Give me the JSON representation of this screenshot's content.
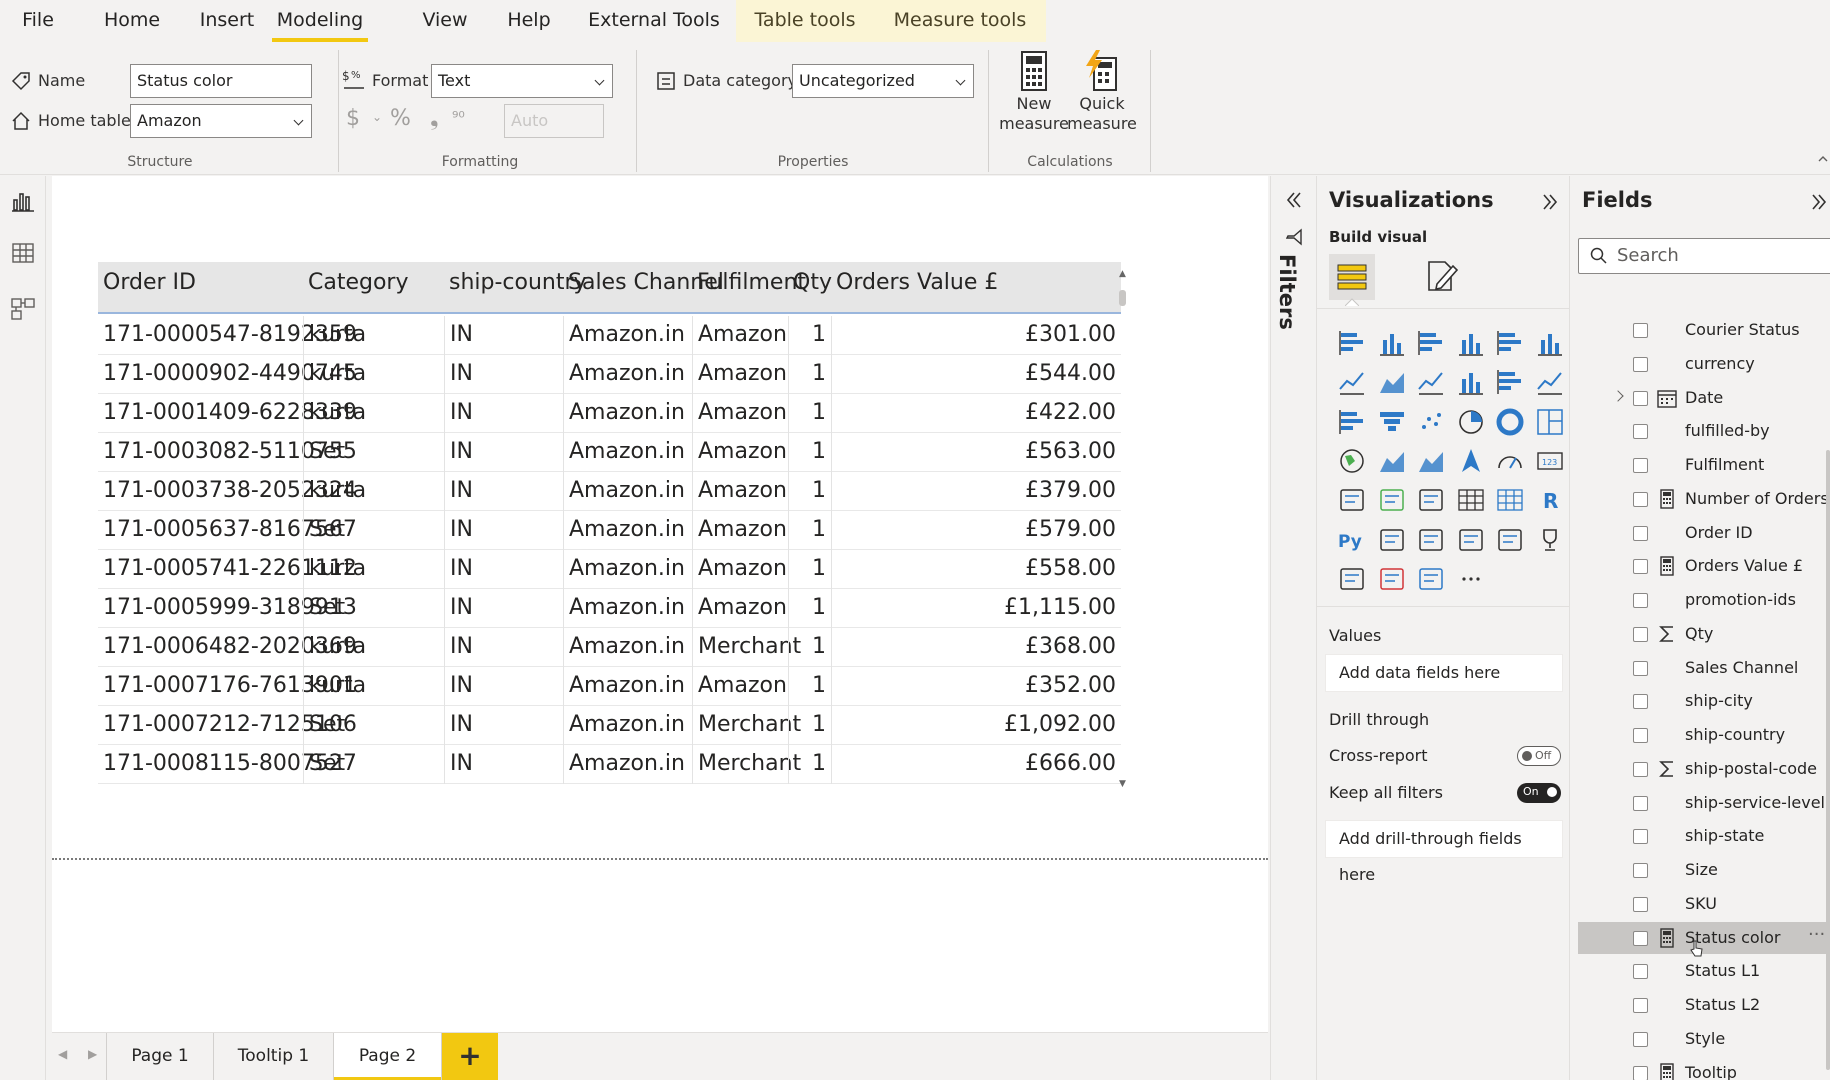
{
  "tabs": [
    "File",
    "Home",
    "Insert",
    "Modeling",
    "View",
    "Help",
    "External Tools",
    "Table tools",
    "Measure tools"
  ],
  "ribbon": {
    "structure": {
      "name_label": "Name",
      "name_value": "Status color",
      "home_table_label": "Home table",
      "home_table_value": "Amazon",
      "title": "Structure"
    },
    "formatting": {
      "format_label": "Format",
      "format_value": "Text",
      "decimals_placeholder": "Auto",
      "title": "Formatting"
    },
    "properties": {
      "data_category_label": "Data category",
      "data_category_value": "Uncategorized",
      "title": "Properties"
    },
    "calculations": {
      "new_measure": [
        "New",
        "measure"
      ],
      "quick_measure": [
        "Quick",
        "measure"
      ],
      "title": "Calculations"
    }
  },
  "table": {
    "columns": [
      "Order ID",
      "Category",
      "ship-country",
      "Sales Channel",
      "Fulfilment",
      "Qty",
      "Orders Value £"
    ],
    "rows": [
      [
        "171-0000547-8192359",
        "kurta",
        "IN",
        "Amazon.in",
        "Amazon",
        "1",
        "£301.00"
      ],
      [
        "171-0000902-4490745",
        "kurta",
        "IN",
        "Amazon.in",
        "Amazon",
        "1",
        "£544.00"
      ],
      [
        "171-0001409-6228339",
        "kurta",
        "IN",
        "Amazon.in",
        "Amazon",
        "1",
        "£422.00"
      ],
      [
        "171-0003082-5110755",
        "Set",
        "IN",
        "Amazon.in",
        "Amazon",
        "1",
        "£563.00"
      ],
      [
        "171-0003738-2052324",
        "kurta",
        "IN",
        "Amazon.in",
        "Amazon",
        "1",
        "£379.00"
      ],
      [
        "171-0005637-8167567",
        "Set",
        "IN",
        "Amazon.in",
        "Amazon",
        "1",
        "£579.00"
      ],
      [
        "171-0005741-2261112",
        "kurta",
        "IN",
        "Amazon.in",
        "Amazon",
        "1",
        "£558.00"
      ],
      [
        "171-0005999-3189913",
        "Set",
        "IN",
        "Amazon.in",
        "Amazon",
        "1",
        "£1,115.00"
      ],
      [
        "171-0006482-2020369",
        "kurta",
        "IN",
        "Amazon.in",
        "Merchant",
        "1",
        "£368.00"
      ],
      [
        "171-0007176-7613901",
        "kurta",
        "IN",
        "Amazon.in",
        "Amazon",
        "1",
        "£352.00"
      ],
      [
        "171-0007212-7125106",
        "Set",
        "IN",
        "Amazon.in",
        "Merchant",
        "1",
        "£1,092.00"
      ],
      [
        "171-0008115-8007527",
        "Set",
        "IN",
        "Amazon.in",
        "Merchant",
        "1",
        "£666.00"
      ]
    ]
  },
  "pages": [
    "Page 1",
    "Tooltip 1",
    "Page 2",
    "+"
  ],
  "filters_label": "Filters",
  "visualizations": {
    "title": "Visualizations",
    "build_visual": "Build visual",
    "values_label": "Values",
    "values_placeholder": "Add data fields here",
    "drill_through_label": "Drill through",
    "cross_report_label": "Cross-report",
    "cross_report_state": "Off",
    "keep_filters_label": "Keep all filters",
    "keep_filters_state": "On",
    "drill_placeholder": "Add drill-through fields here"
  },
  "fields_pane": {
    "title": "Fields",
    "search_placeholder": "Search",
    "items": [
      {
        "name": "Courier Status",
        "type": "none"
      },
      {
        "name": "currency",
        "type": "none"
      },
      {
        "name": "Date",
        "type": "calendar",
        "expandable": true
      },
      {
        "name": "fulfilled-by",
        "type": "none"
      },
      {
        "name": "Fulfilment",
        "type": "none"
      },
      {
        "name": "Number of Orders",
        "type": "calculator"
      },
      {
        "name": "Order ID",
        "type": "none"
      },
      {
        "name": "Orders Value £",
        "type": "calculator"
      },
      {
        "name": "promotion-ids",
        "type": "none"
      },
      {
        "name": "Qty",
        "type": "sigma"
      },
      {
        "name": "Sales Channel",
        "type": "none"
      },
      {
        "name": "ship-city",
        "type": "none"
      },
      {
        "name": "ship-country",
        "type": "none"
      },
      {
        "name": "ship-postal-code",
        "type": "sigma"
      },
      {
        "name": "ship-service-level",
        "type": "none"
      },
      {
        "name": "ship-state",
        "type": "none"
      },
      {
        "name": "Size",
        "type": "none"
      },
      {
        "name": "SKU",
        "type": "none"
      },
      {
        "name": "Status color",
        "type": "calculator",
        "hovered": true
      },
      {
        "name": "Status L1",
        "type": "none"
      },
      {
        "name": "Status L2",
        "type": "none"
      },
      {
        "name": "Style",
        "type": "none"
      },
      {
        "name": "Tooltip",
        "type": "calculator"
      }
    ]
  },
  "colors": {
    "accent": "#f2c811",
    "context_tab_bg": "#fbf5d5",
    "r_visual": "#2d79c7",
    "py_visual": "#2d79c7"
  }
}
